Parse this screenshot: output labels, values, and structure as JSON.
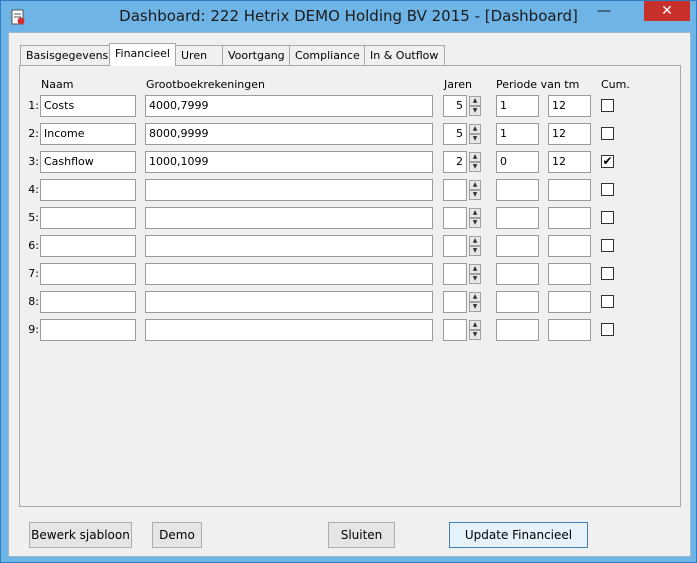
{
  "window": {
    "title": "Dashboard: 222 Hetrix DEMO Holding BV 2015 - [Dashboard]",
    "minimize_glyph": "—",
    "close_glyph": "✕"
  },
  "tabs": [
    {
      "label": "Basisgegevens",
      "active": false
    },
    {
      "label": "Financieel",
      "active": true
    },
    {
      "label": "Uren",
      "active": false
    },
    {
      "label": "Voortgang",
      "active": false
    },
    {
      "label": "Compliance",
      "active": false
    },
    {
      "label": "In & Outflow",
      "active": false
    }
  ],
  "headers": {
    "naam": "Naam",
    "grootboek": "Grootboekrekeningen",
    "jaren": "Jaren",
    "periode": "Periode van tm",
    "cum": "Cum."
  },
  "rows": [
    {
      "num": "1:",
      "naam": "Costs",
      "grootboek": "4000,7999",
      "jaren": "5",
      "van": "1",
      "tm": "12",
      "cum": false
    },
    {
      "num": "2:",
      "naam": "Income",
      "grootboek": "8000,9999",
      "jaren": "5",
      "van": "1",
      "tm": "12",
      "cum": false
    },
    {
      "num": "3:",
      "naam": "Cashflow",
      "grootboek": "1000,1099",
      "jaren": "2",
      "van": "0",
      "tm": "12",
      "cum": true
    },
    {
      "num": "4:",
      "naam": "",
      "grootboek": "",
      "jaren": "",
      "van": "",
      "tm": "",
      "cum": false
    },
    {
      "num": "5:",
      "naam": "",
      "grootboek": "",
      "jaren": "",
      "van": "",
      "tm": "",
      "cum": false
    },
    {
      "num": "6:",
      "naam": "",
      "grootboek": "",
      "jaren": "",
      "van": "",
      "tm": "",
      "cum": false
    },
    {
      "num": "7:",
      "naam": "",
      "grootboek": "",
      "jaren": "",
      "van": "",
      "tm": "",
      "cum": false
    },
    {
      "num": "8:",
      "naam": "",
      "grootboek": "",
      "jaren": "",
      "van": "",
      "tm": "",
      "cum": false
    },
    {
      "num": "9:",
      "naam": "",
      "grootboek": "",
      "jaren": "",
      "van": "",
      "tm": "",
      "cum": false
    }
  ],
  "buttons": {
    "bewerk": "Bewerk sjabloon",
    "demo": "Demo",
    "sluiten": "Sluiten",
    "update": "Update Financieel"
  },
  "icons": {
    "app": "dashboard-app-icon",
    "check": "✔"
  },
  "colors": {
    "titlebar": "#6fb4e6",
    "close": "#c7302b"
  }
}
